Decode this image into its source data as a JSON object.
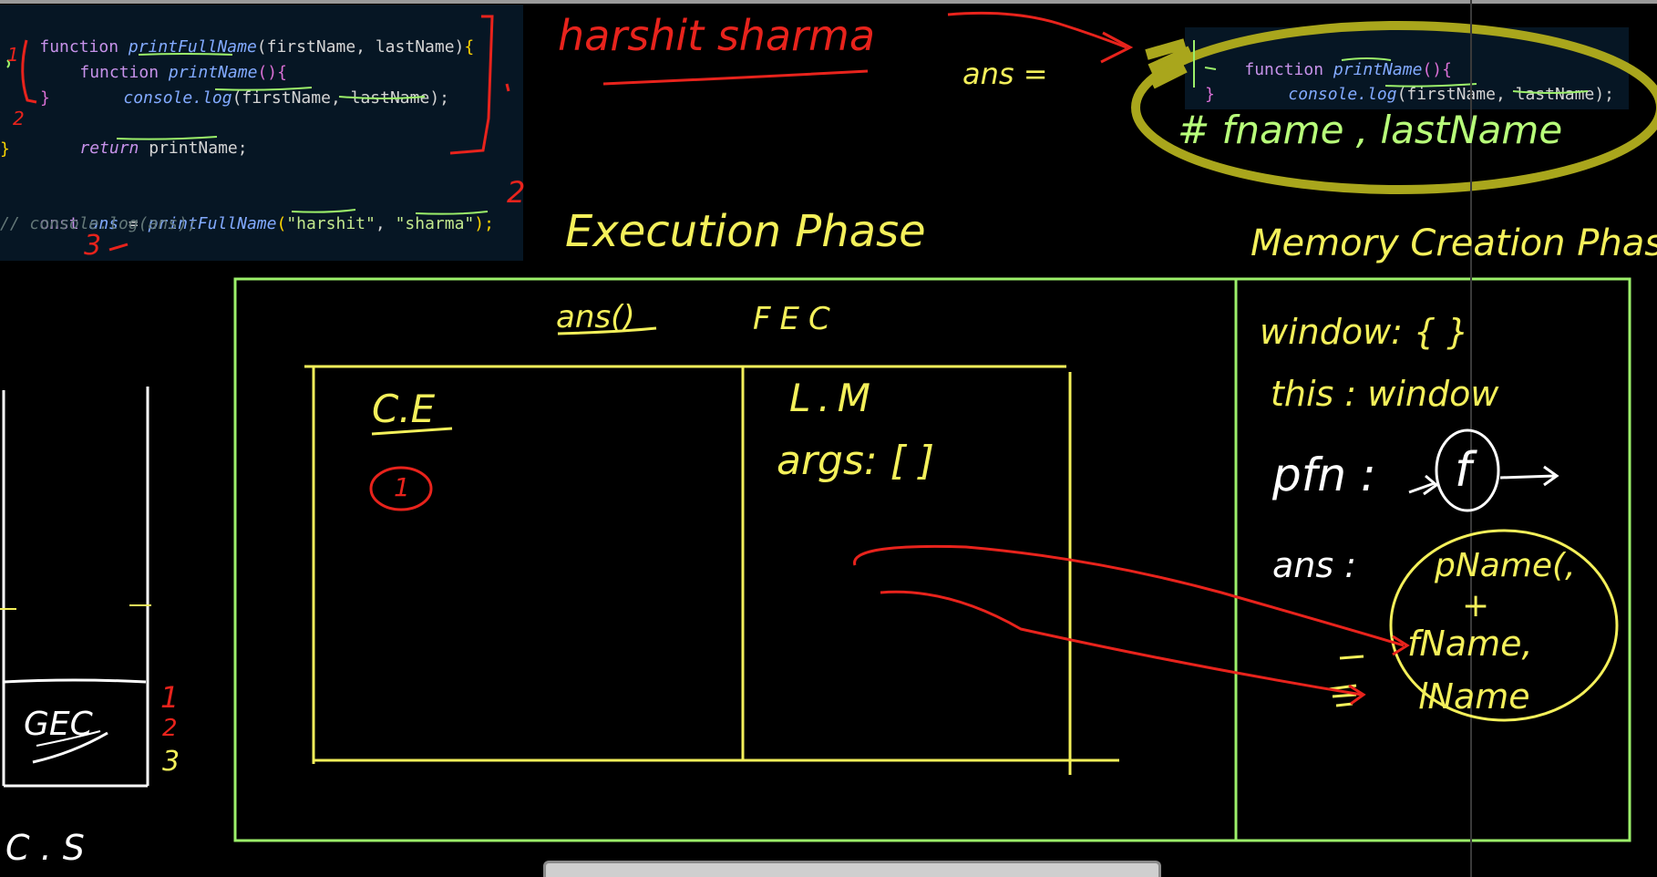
{
  "code_main": {
    "line1": {
      "kw": "function",
      "name": "printFullName",
      "params": "(firstName, lastName)",
      "brace": "{"
    },
    "line2": {
      "kw": "function",
      "name": "printName",
      "rest": "(){"
    },
    "line3": {
      "obj": "console.",
      "method": "log",
      "args": "(firstName, lastName);"
    },
    "line4": "}",
    "line5": {
      "kw": "return",
      "val": " printName;"
    },
    "line6": "}",
    "line7": {
      "kw": "onst",
      "ansname": " ans",
      "eq": " = ",
      "call": "printFullName",
      "args_open": "(",
      "s1": "\"harshit\"",
      "comma": ", ",
      "s2": "\"sharma\"",
      "close": ");"
    },
    "line8": "// console.log(ans);",
    "line9": {
      "ans": "ans",
      "rest": "();"
    }
  },
  "code_zoom": {
    "line1": {
      "kw": "function",
      "name": "printName",
      "rest": "(){"
    },
    "line2": {
      "obj": "console.",
      "method": "log",
      "args": "(firstName, lastName);"
    },
    "line3": "}"
  },
  "annotations": {
    "name_note": "harshit sharma",
    "ans_eq": "ans =",
    "fname_lastname": "# fname , lastName",
    "exec_phase": "Execution Phase",
    "mem_phase": "Memory Creation Phase",
    "ans_call": "ans()",
    "fec": "FEC",
    "ce": "C.E",
    "ce_circle": "1",
    "lm": "L.M",
    "args": "args: [ ]",
    "window": "window: {   }",
    "this": "this : window",
    "pfn": "pfn :",
    "f_circle": "f",
    "ans_label": "ans :",
    "circle_l1": "pName(,",
    "circle_l2": "+",
    "circle_l3": "fName,",
    "circle_l4": "lName",
    "gec": "GEC",
    "cs": "C . S",
    "n2": "2",
    "n3": "3",
    "n2_side": "2",
    "stack1": "1",
    "stack2": "2",
    "stack3": "3",
    "m1": "1",
    "m2": "2"
  },
  "colors": {
    "bg": "#000000",
    "code_bg": "#061624",
    "frame_green": "#9cf06a",
    "box_yellow": "#f4f05a",
    "highlight_olive": "#a9a61c",
    "pen_red": "#e8231c"
  }
}
